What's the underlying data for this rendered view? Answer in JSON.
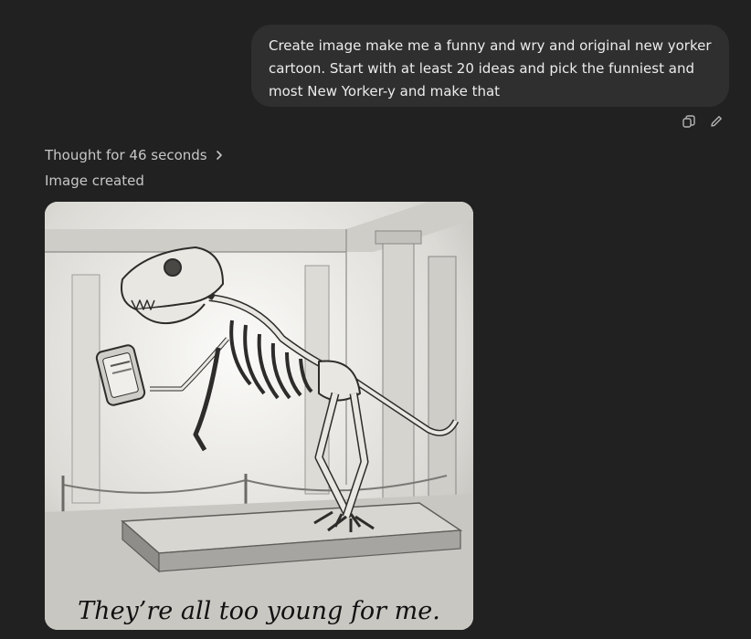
{
  "user_message": {
    "text": "Create image make me a funny and wry and original new yorker cartoon. Start with at least 20 ideas and pick the funniest and most New Yorker-y and make that"
  },
  "message_actions": [
    {
      "icon": "copy-icon"
    },
    {
      "icon": "edit-icon"
    }
  ],
  "assistant": {
    "thought_label": "Thought for 46 seconds",
    "status": "Image created",
    "image": {
      "subject": "pencil-sketch-trex-skeleton-with-phone",
      "caption": "They’re all too young for me."
    }
  },
  "colors": {
    "background": "#212121",
    "bubble": "#2f2f2f",
    "text": "#ececec",
    "muted": "#c7c7c7"
  }
}
